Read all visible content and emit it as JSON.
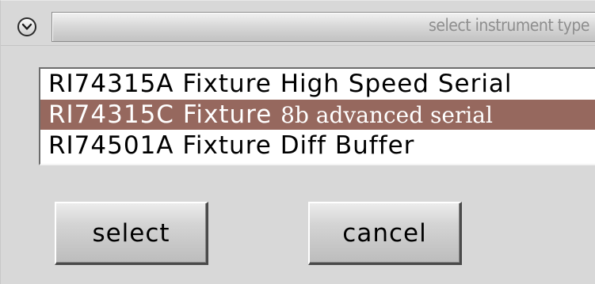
{
  "dialog": {
    "title": "select instrument type",
    "collapse_icon": "chevron-down-icon"
  },
  "instrument_list": {
    "items": [
      {
        "code": "RI74315A",
        "kind": "Fixture",
        "description": "High Speed Serial",
        "selected": false
      },
      {
        "code": "RI74315C",
        "kind": "Fixture",
        "description": "8b advanced serial",
        "selected": true
      },
      {
        "code": "RI74501A",
        "kind": "Fixture",
        "description": "Diff Buffer",
        "selected": false
      }
    ]
  },
  "buttons": {
    "select_label": "select",
    "cancel_label": "cancel"
  },
  "colors": {
    "selection_background": "#96685e",
    "dialog_background": "#d8d8d8"
  }
}
